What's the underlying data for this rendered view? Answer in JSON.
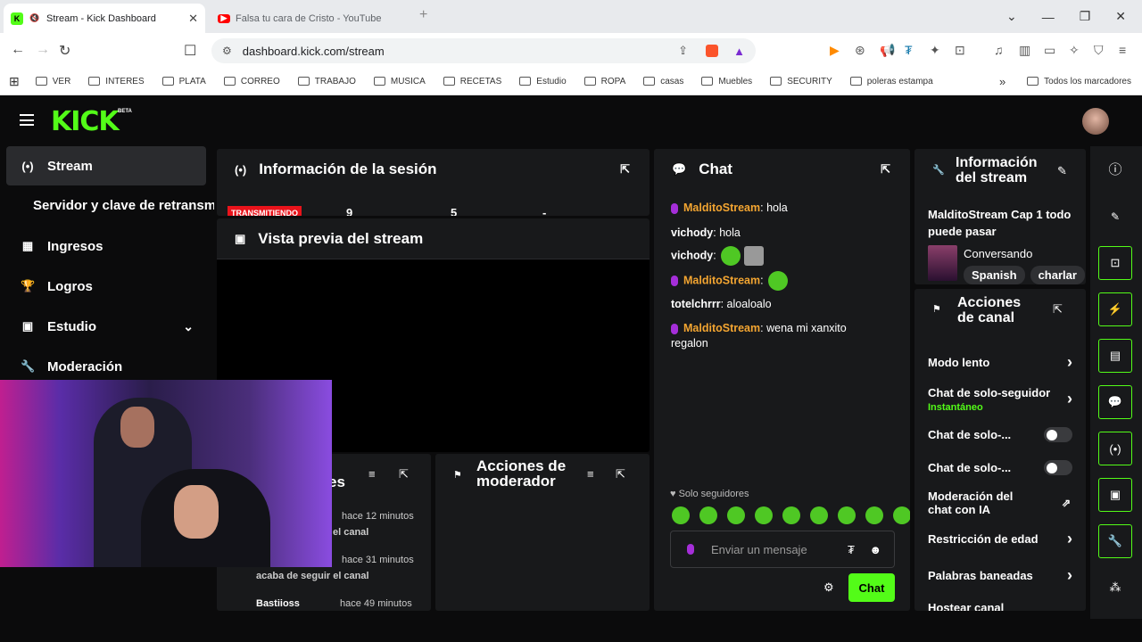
{
  "browser": {
    "tabs": [
      {
        "label": "Stream - Kick Dashboard",
        "active": true
      },
      {
        "label": "Falsa tu cara de Cristo - YouTube",
        "active": false
      }
    ],
    "url": "dashboard.kick.com/stream",
    "bookmarks": [
      "VER",
      "INTERES",
      "PLATA",
      "CORREO",
      "TRABAJO",
      "MUSICA",
      "RECETAS",
      "Estudio",
      "ROPA",
      "casas",
      "Muebles",
      "SECURITY",
      "poleras estampa"
    ],
    "all_bookmarks": "Todos los marcadores"
  },
  "logo": "KICK",
  "beta": "BETA",
  "sidebar": {
    "stream": "Stream",
    "server": "Servidor y clave de retransmisión",
    "ingresos": "Ingresos",
    "logros": "Logros",
    "estudio": "Estudio",
    "moderacion": "Moderación"
  },
  "session": {
    "title": "Información de la sesión",
    "live": "TRANSMITIENDO",
    "stats": [
      "9",
      "5",
      "-"
    ]
  },
  "preview": {
    "title": "Vista previa del stream"
  },
  "feed": {
    "title_suffix": "es",
    "rows": [
      {
        "time": "hace 12 minutos",
        "text": "el canal"
      },
      {
        "time": "hace 31 minutos",
        "text": "acaba de seguir el canal"
      },
      {
        "name": "Bastiioss",
        "time": "hace 49 minutos"
      }
    ]
  },
  "modactions": {
    "title": "Acciones de moderador"
  },
  "chat": {
    "title": "Chat",
    "messages": [
      {
        "user": "MalditoStream",
        "text": "hola",
        "color": "#f3a531",
        "mic": true
      },
      {
        "user": "vichody",
        "text": "hola",
        "color": "#ffffff",
        "mic": false
      },
      {
        "user": "vichody",
        "text": "",
        "color": "#ffffff",
        "mic": false,
        "emotes": 2
      },
      {
        "user": "MalditoStream",
        "text": "",
        "color": "#f3a531",
        "mic": true,
        "emotes": 1
      },
      {
        "user": "totelchrrr",
        "text": "aloaloalo",
        "color": "#ffffff",
        "mic": false
      },
      {
        "user": "MalditoStream",
        "text": "wena mi xanxito regalon",
        "color": "#f3a531",
        "mic": true
      }
    ],
    "followers_only": "Solo seguidores",
    "placeholder": "Enviar un mensaje",
    "send": "Chat"
  },
  "streaminfo": {
    "title_l1": "Información",
    "title_l2": "del stream",
    "stream_title": "MalditoStream Cap 1 todo puede pasar",
    "category": "Conversando",
    "tags": [
      "Spanish",
      "charlar"
    ]
  },
  "channel": {
    "title_l1": "Acciones",
    "title_l2": "de canal",
    "items": [
      {
        "label": "Modo lento",
        "type": "chevron"
      },
      {
        "label": "Chat de solo-seguidor",
        "sub": "Instantáneo",
        "type": "chevron"
      },
      {
        "label": "Chat de solo-...",
        "type": "toggle"
      },
      {
        "label": "Chat de solo-...",
        "type": "toggle"
      },
      {
        "label": "Moderación del chat con IA",
        "type": "external"
      },
      {
        "label": "Restricción de edad",
        "type": "chevron"
      },
      {
        "label": "Palabras baneadas",
        "type": "chevron"
      },
      {
        "label": "Hostear canal",
        "type": "none"
      }
    ]
  },
  "colors": {
    "accent": "#53fc18",
    "live": "#e9131b",
    "instant": "#53fc18"
  }
}
